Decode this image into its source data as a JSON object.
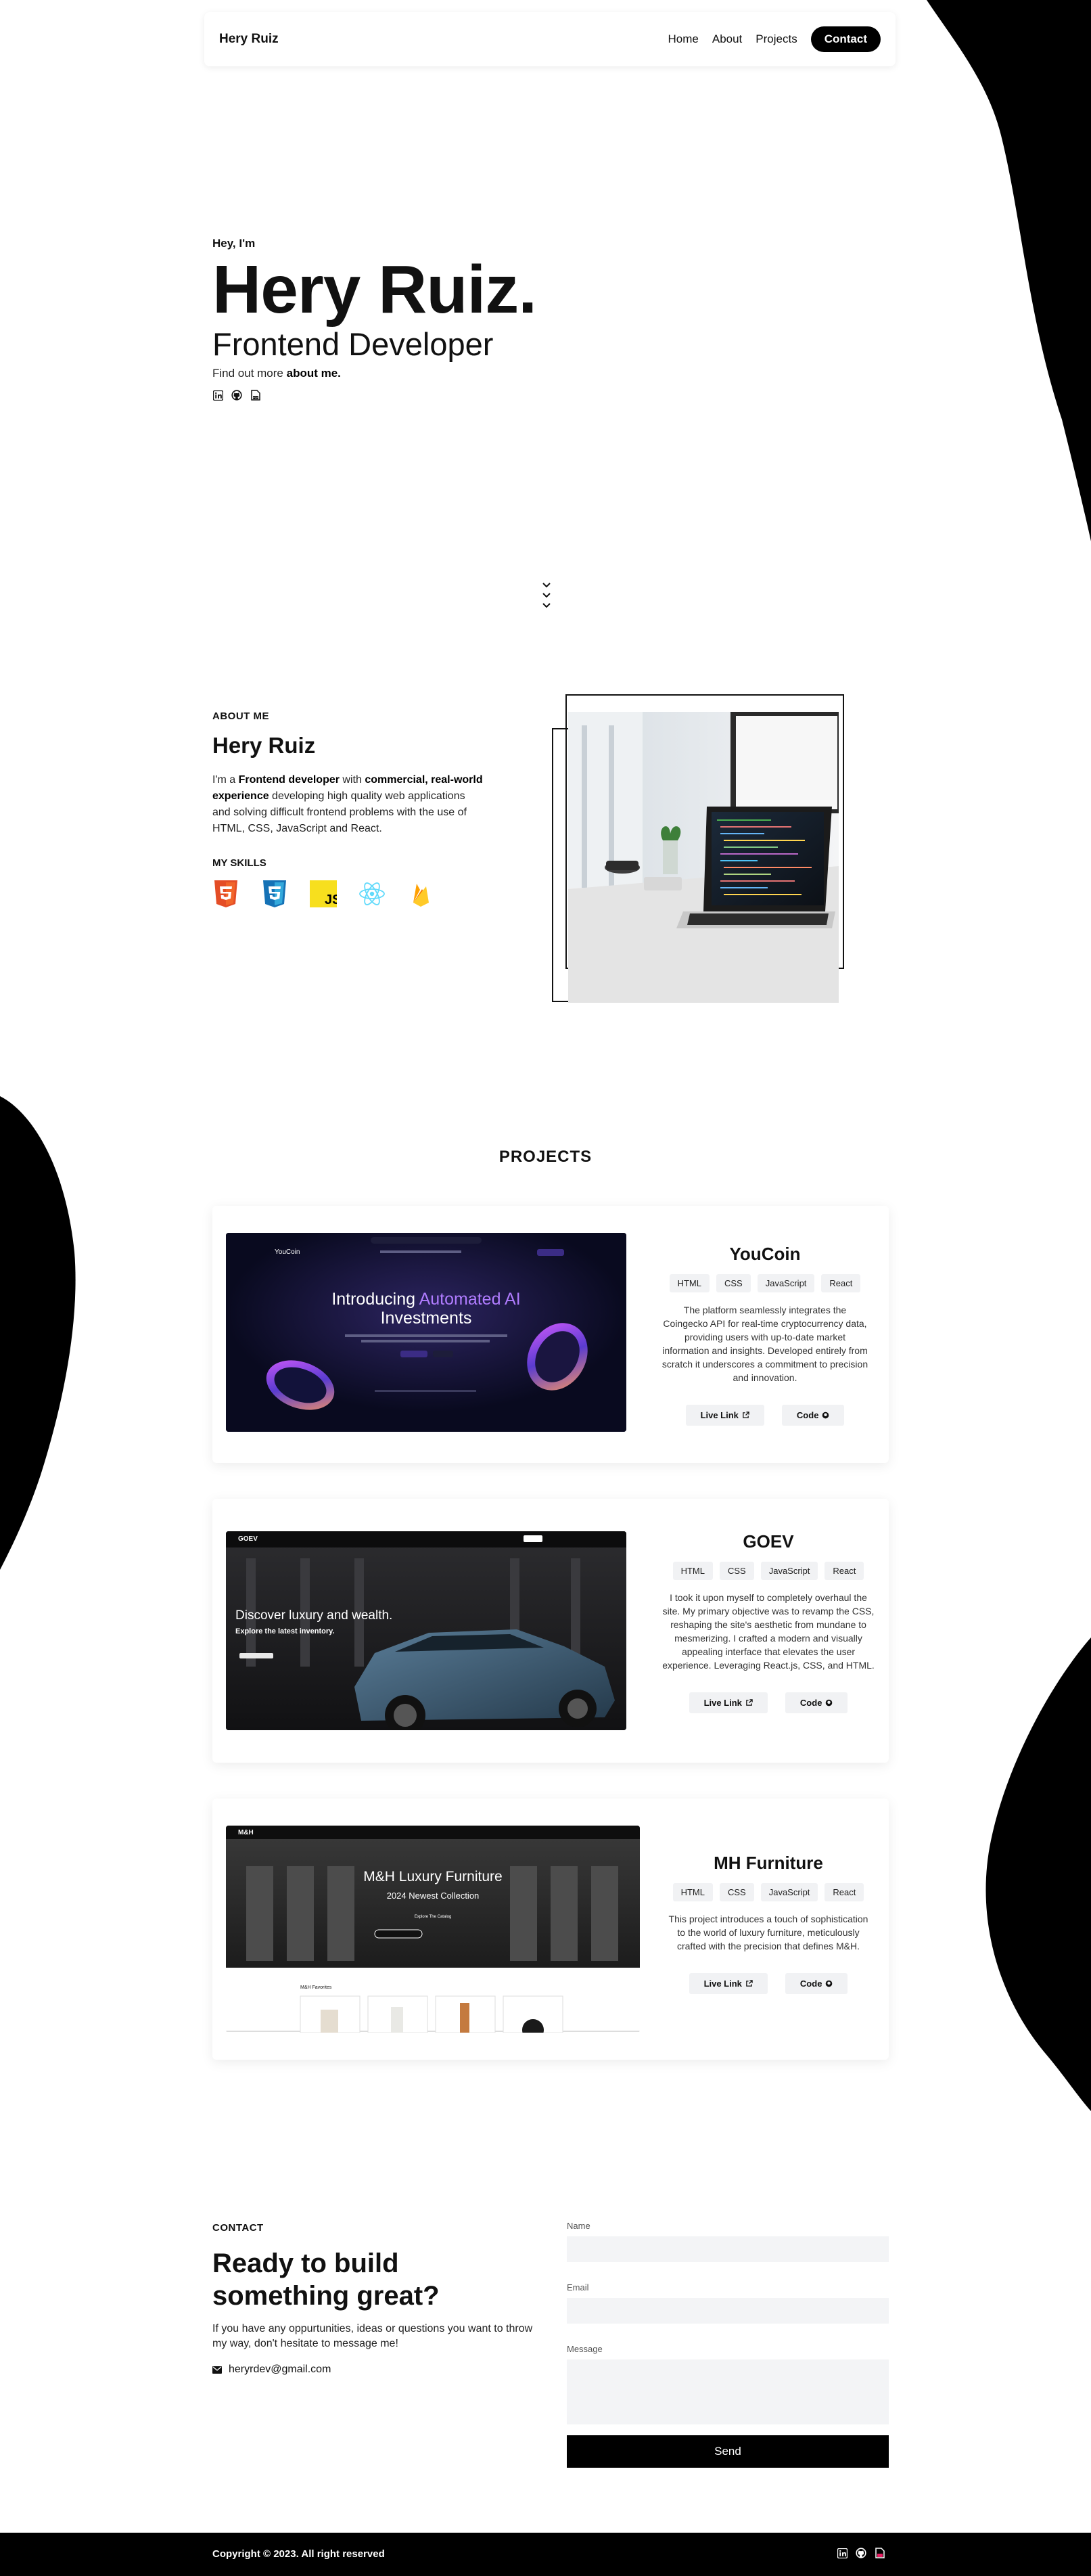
{
  "nav": {
    "brand": "Hery Ruiz",
    "links": [
      "Home",
      "About",
      "Projects"
    ],
    "contact_label": "Contact"
  },
  "hero": {
    "greeting": "Hey, I'm",
    "name": "Hery Ruiz.",
    "role": "Frontend Developer",
    "more_prefix": "Find out more",
    "more_link": "about me.",
    "icons": [
      "linkedin-icon",
      "github-icon",
      "resume-icon"
    ]
  },
  "about": {
    "kicker": "ABOUT ME",
    "heading": "Hery Ruiz",
    "p_1": "I'm a ",
    "p_bold_1": "Frontend developer",
    "p_2": " with ",
    "p_bold_2": "commercial, real-world experience",
    "p_3": " developing high quality web applications and solving difficult frontend problems with the use of HTML, CSS, JavaScript and React.",
    "skills_title": "MY SKILLS",
    "skills": [
      "html5-icon",
      "css3-icon",
      "javascript-icon",
      "react-icon",
      "firebase-icon"
    ]
  },
  "projects": {
    "title": "PROJECTS",
    "items": [
      {
        "title": "YouCoin",
        "tags": [
          "HTML",
          "CSS",
          "JavaScript",
          "React"
        ],
        "description": "The platform seamlessly integrates the Coingecko API for real-time cryptocurrency data, providing users with up-to-date market information and insights. Developed entirely from scratch it underscores a commitment to precision and innovation.",
        "live_label": "Live Link",
        "code_label": "Code",
        "shot": {
          "logo": "YouCoin",
          "headline_1": "Introducing ",
          "headline_accent": "Automated AI",
          "headline_2": "Investments"
        }
      },
      {
        "title": "GOEV",
        "tags": [
          "HTML",
          "CSS",
          "JavaScript",
          "React"
        ],
        "description": "I took it upon myself to completely overhaul the site. My primary objective was to revamp the CSS, reshaping the site's aesthetic from mundane to mesmerizing. I crafted a modern and visually appealing interface that elevates the user experience. Leveraging React.js, CSS, and HTML.",
        "live_label": "Live Link",
        "code_label": "Code",
        "shot": {
          "logo": "GOEV",
          "headline": "Discover luxury and wealth.",
          "sub": "Explore the latest inventory."
        }
      },
      {
        "title": "MH Furniture",
        "tags": [
          "HTML",
          "CSS",
          "JavaScript",
          "React"
        ],
        "description": "This project introduces a touch of sophistication to the world of luxury furniture, meticulously crafted with the precision that defines M&H.",
        "live_label": "Live Link",
        "code_label": "Code",
        "shot": {
          "logo": "M&H",
          "headline": "M&H Luxury Furniture",
          "sub": "2024 Newest Collection",
          "cta": "Explore The Catalog",
          "favorites": "M&H Favorites"
        }
      }
    ]
  },
  "contact": {
    "kicker": "CONTACT",
    "heading": "Ready to build something great?",
    "text": "If you have any oppurtunities, ideas or questions you want to throw my way, don't hesitate to message me!",
    "email": "heryrdev@gmail.com",
    "name_label": "Name",
    "email_label": "Email",
    "message_label": "Message",
    "send_label": "Send"
  },
  "footer": {
    "copyright": "Copyright © 2023. All right reserved"
  },
  "colors": {
    "accent": "#000000",
    "background": "#ffffff",
    "field": "#f3f4f6"
  }
}
